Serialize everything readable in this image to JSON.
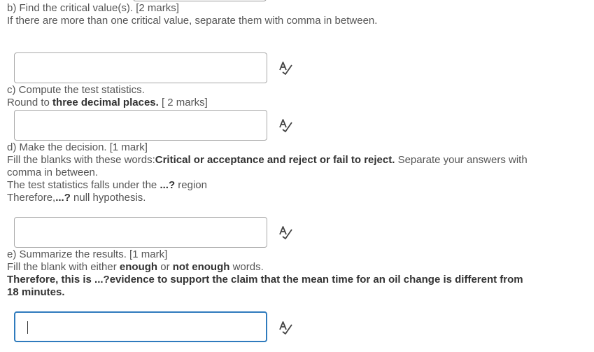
{
  "part_b": {
    "title": "b) Find the critical value(s). [2 marks]",
    "instruction": "If there are more than one critical value, separate them with comma in between."
  },
  "part_c": {
    "title": "c) Compute the test statistics.",
    "round_prefix": "Round to ",
    "round_bold": "three decimal places.",
    "round_suffix": " [ 2 marks]"
  },
  "part_d": {
    "title": "d) Make the decision. [1 mark]",
    "fill_prefix": "Fill the blanks with these words:",
    "fill_bold": "Critical or acceptance and reject or fail to reject.",
    "fill_suffix": " Separate your answers with",
    "fill_continued": "comma in between.",
    "stat_prefix": "The test statistics falls under the ",
    "stat_bold": "...?",
    "stat_suffix": " region",
    "therefore_prefix": "Therefore,",
    "therefore_bold": "...?",
    "therefore_suffix": " null hypothesis."
  },
  "part_e": {
    "title": "e) Summarize the results. [1 mark]",
    "fill_prefix": "Fill the blank with either ",
    "fill_bold1": "enough",
    "fill_mid": " or ",
    "fill_bold2": "not enough",
    "fill_suffix": " words.",
    "statement_line1": "Therefore, this is ...?evidence to support the claim that the mean time for an oil change is different from",
    "statement_line2": "18 minutes."
  },
  "inputs": {
    "b_value": "",
    "c_value": "",
    "d_value": "",
    "e_value": ""
  },
  "icons": {
    "spellcheck": "spellcheck-icon"
  }
}
